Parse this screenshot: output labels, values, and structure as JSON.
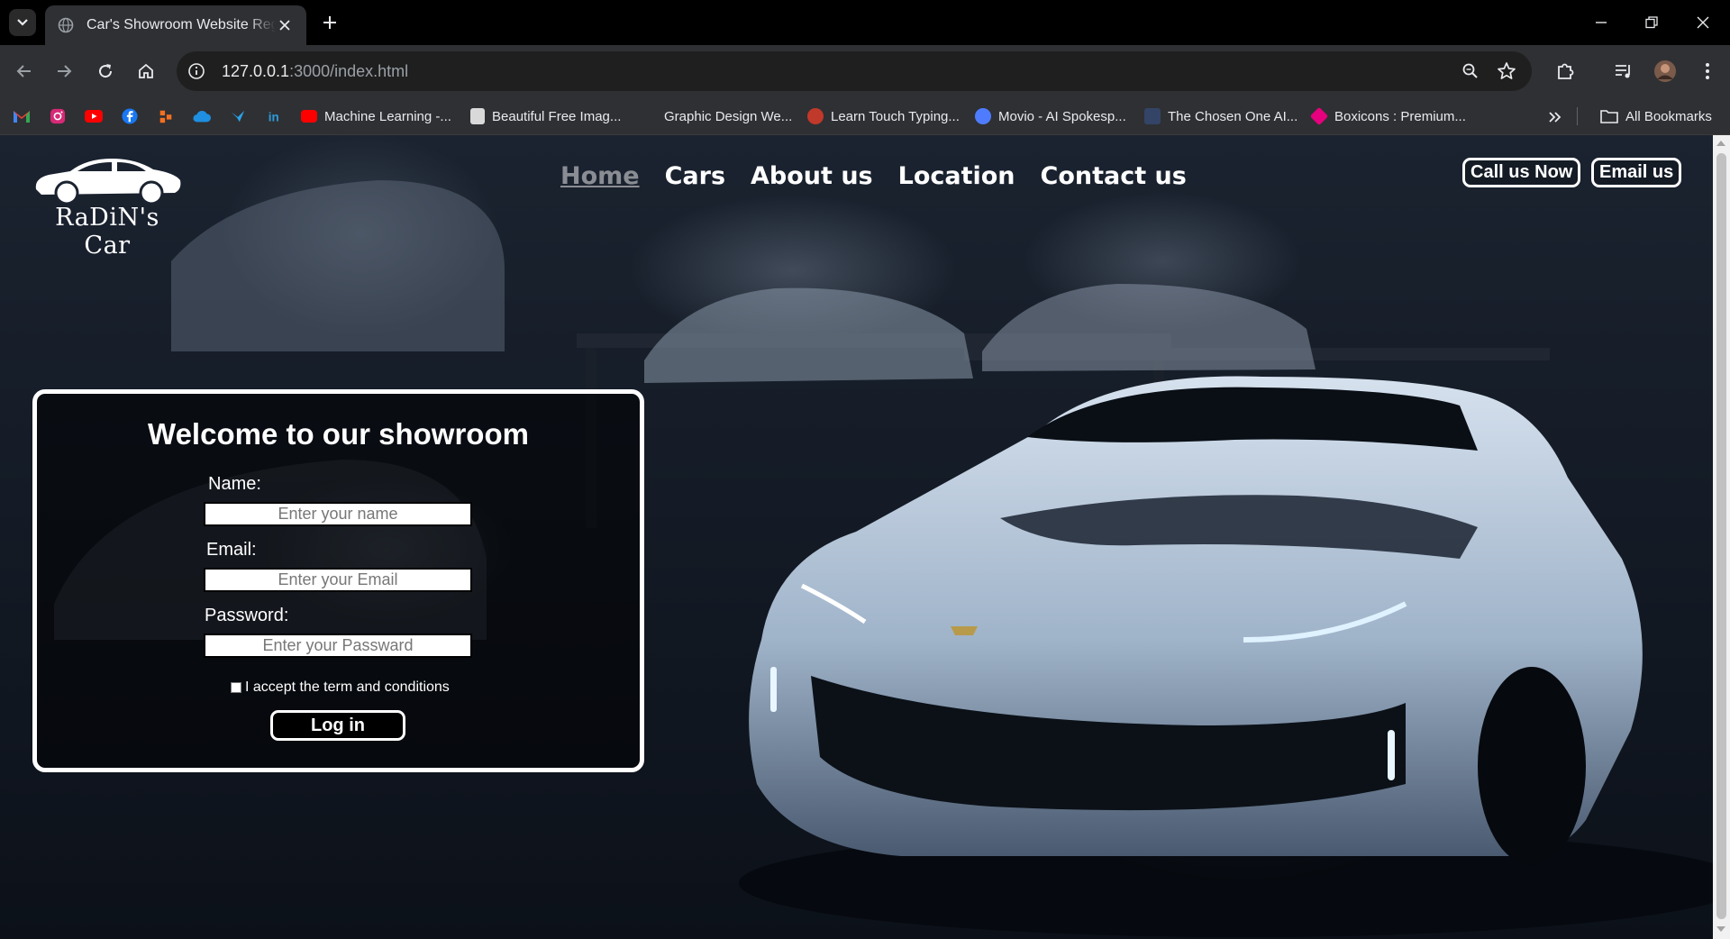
{
  "browser": {
    "tab_title": "Car's Showroom Website Registration",
    "url_host": "127.0.0.1",
    "url_path": ":3000/index.html",
    "bookmarks": [
      {
        "label": "Machine Learning -...",
        "color": "#ff0000"
      },
      {
        "label": "Beautiful Free Imag...",
        "color": "#111111"
      },
      {
        "label": "Graphic Design We...",
        "color": "#2f3033"
      },
      {
        "label": "Learn Touch Typing...",
        "color": "#c0392b"
      },
      {
        "label": "Movio - AI Spokesp...",
        "color": "#4f7cff"
      },
      {
        "label": "The Chosen One AI...",
        "color": "#334466"
      },
      {
        "label": "Boxicons : Premium...",
        "color": "#e6007e"
      }
    ],
    "all_bookmarks": "All Bookmarks"
  },
  "site": {
    "logo_text": "RaDiN's Car",
    "nav": [
      "Home",
      "Cars",
      "About us",
      "Location",
      "Contact us"
    ],
    "active_nav": "Home",
    "call_button": "Call us Now",
    "email_button": "Email us"
  },
  "login": {
    "title": "Welcome to our showroom",
    "name_label": "Name:",
    "name_placeholder": "Enter your name",
    "email_label": "Email:",
    "email_placeholder": "Enter your Email",
    "password_label": "Password:",
    "password_placeholder": "Enter your Passward",
    "terms_label": "I accept the term and conditions",
    "submit_label": "Log in"
  }
}
